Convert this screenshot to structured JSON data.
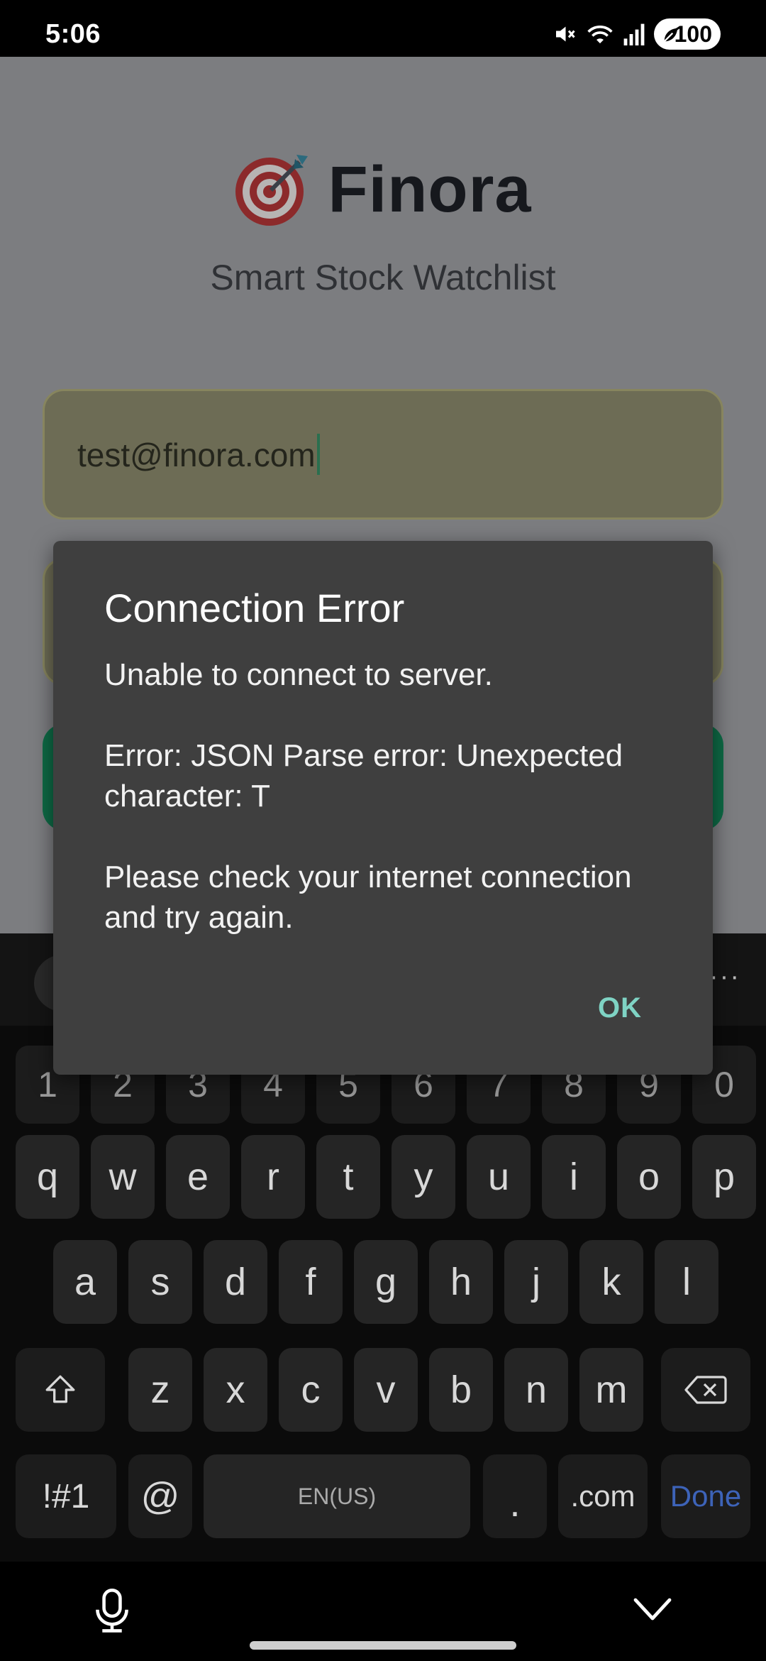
{
  "status_bar": {
    "time": "5:06",
    "battery": "100",
    "icons": [
      "mute-icon",
      "wifi-icon",
      "signal-icon",
      "battery-icon"
    ]
  },
  "app": {
    "logo_icon": "target-dart-icon",
    "title": "Finora",
    "subtitle": "Smart Stock Watchlist",
    "email_value": "test@finora.com",
    "accent_color": "#0e6b46"
  },
  "dialog": {
    "title": "Connection Error",
    "message": "Unable to connect to server.\n\nError: JSON Parse error: Unexpected character: T\n\nPlease check your internet connection and try again.",
    "ok_label": "OK"
  },
  "keyboard": {
    "number_row": [
      "1",
      "2",
      "3",
      "4",
      "5",
      "6",
      "7",
      "8",
      "9",
      "0"
    ],
    "row1": [
      "q",
      "w",
      "e",
      "r",
      "t",
      "y",
      "u",
      "i",
      "o",
      "p"
    ],
    "row2": [
      "a",
      "s",
      "d",
      "f",
      "g",
      "h",
      "j",
      "k",
      "l"
    ],
    "row3": [
      "z",
      "x",
      "c",
      "v",
      "b",
      "n",
      "m"
    ],
    "symbols_label": "!#1",
    "at_label": "@",
    "space_label": "EN(US)",
    "period_label": ".",
    "dotcom_label": ".com",
    "done_label": "Done",
    "more_label": "···"
  }
}
